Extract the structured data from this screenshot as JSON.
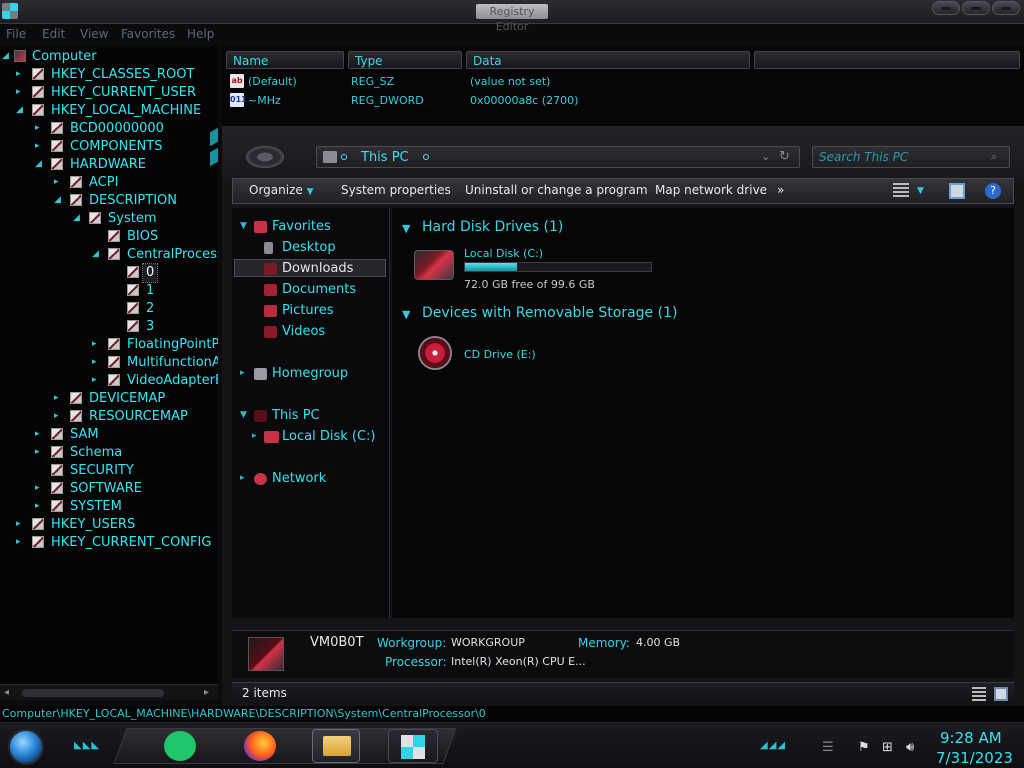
{
  "window": {
    "title": "Registry Editor"
  },
  "menu": [
    "File",
    "Edit",
    "View",
    "Favorites",
    "Help"
  ],
  "tree": [
    {
      "label": "Computer",
      "level": 0
    },
    {
      "label": "HKEY_CLASSES_ROOT",
      "level": 1
    },
    {
      "label": "HKEY_CURRENT_USER",
      "level": 1
    },
    {
      "label": "HKEY_LOCAL_MACHINE",
      "level": 1
    },
    {
      "label": "BCD00000000",
      "level": 2
    },
    {
      "label": "COMPONENTS",
      "level": 2
    },
    {
      "label": "HARDWARE",
      "level": 2
    },
    {
      "label": "ACPI",
      "level": 3
    },
    {
      "label": "DESCRIPTION",
      "level": 3
    },
    {
      "label": "System",
      "level": 4
    },
    {
      "label": "BIOS",
      "level": 5
    },
    {
      "label": "CentralProcess",
      "level": 5
    },
    {
      "label": "0",
      "level": 6,
      "selected": true
    },
    {
      "label": "1",
      "level": 6
    },
    {
      "label": "2",
      "level": 6
    },
    {
      "label": "3",
      "level": 6
    },
    {
      "label": "FloatingPointP",
      "level": 5
    },
    {
      "label": "MultifunctionAc",
      "level": 5
    },
    {
      "label": "VideoAdapterB",
      "level": 5
    },
    {
      "label": "DEVICEMAP",
      "level": 3
    },
    {
      "label": "RESOURCEMAP",
      "level": 3
    },
    {
      "label": "SAM",
      "level": 2
    },
    {
      "label": "Schema",
      "level": 2
    },
    {
      "label": "SECURITY",
      "level": 2
    },
    {
      "label": "SOFTWARE",
      "level": 2
    },
    {
      "label": "SYSTEM",
      "level": 2
    },
    {
      "label": "HKEY_USERS",
      "level": 1
    },
    {
      "label": "HKEY_CURRENT_CONFIG",
      "level": 1
    }
  ],
  "values": {
    "columns": [
      "Name",
      "Type",
      "Data"
    ],
    "rows": [
      {
        "icon": "ab",
        "name": "(Default)",
        "type": "REG_SZ",
        "data": "(value not set)"
      },
      {
        "icon": "011",
        "name": "~MHz",
        "type": "REG_DWORD",
        "data": "0x00000a8c (2700)"
      }
    ]
  },
  "explorer": {
    "address": "This PC",
    "search_placeholder": "Search This PC",
    "commands": [
      "Organize",
      "System properties",
      "Uninstall or change a program",
      "Map network drive",
      "»"
    ],
    "nav": {
      "favorites": "Favorites",
      "desktop": "Desktop",
      "downloads": "Downloads",
      "documents": "Documents",
      "pictures": "Pictures",
      "videos": "Videos",
      "homegroup": "Homegroup",
      "this_pc": "This PC",
      "local_disk": "Local Disk (C:)",
      "network": "Network"
    },
    "groups": {
      "hdd": "Hard Disk Drives (1)",
      "removable": "Devices with Removable Storage (1)"
    },
    "drive_c": {
      "name": "Local Disk (C:)",
      "free": "72.0 GB free of 99.6 GB",
      "used_fraction": 0.277
    },
    "cd_drive": {
      "name": "CD Drive (E:)"
    },
    "details": {
      "computer_name": "VM0B0T",
      "workgroup_label": "Workgroup:",
      "workgroup": "WORKGROUP",
      "memory_label": "Memory:",
      "memory": "4.00 GB",
      "processor_label": "Processor:",
      "processor": "Intel(R) Xeon(R) CPU E..."
    },
    "status": "2 items"
  },
  "status_path": "Computer\\HKEY_LOCAL_MACHINE\\HARDWARE\\DESCRIPTION\\System\\CentralProcessor\\0",
  "taskbar": {
    "time": "9:28 AM",
    "date": "7/31/2023"
  },
  "colors": {
    "accent": "#34e6f5",
    "background": "#0b0b0d",
    "highlight": "#d9314a"
  }
}
